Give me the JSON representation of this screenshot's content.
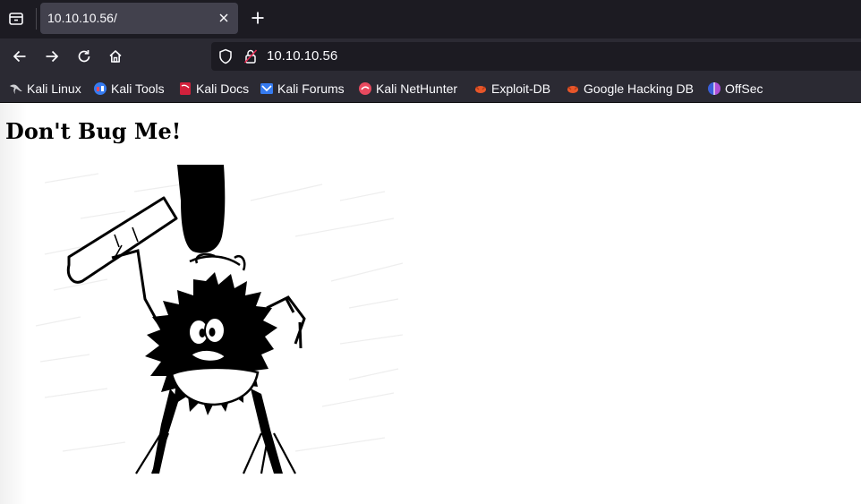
{
  "browser": {
    "tab": {
      "title": "10.10.10.56/",
      "close_icon": "close-icon"
    },
    "new_tab_icon": "plus-icon",
    "tab_list_icon": "tab-list-icon",
    "nav": {
      "back_icon": "arrow-left-icon",
      "forward_icon": "arrow-right-icon",
      "reload_icon": "reload-icon",
      "home_icon": "home-icon"
    },
    "url": "10.10.10.56",
    "bookmarks": [
      {
        "label": "Kali Linux",
        "icon": "kali-dragon-icon"
      },
      {
        "label": "Kali Tools",
        "icon": "kali-tools-icon"
      },
      {
        "label": "Kali Docs",
        "icon": "kali-docs-icon"
      },
      {
        "label": "Kali Forums",
        "icon": "kali-forums-icon"
      },
      {
        "label": "Kali NetHunter",
        "icon": "kali-nethunter-icon"
      },
      {
        "label": "Exploit-DB",
        "icon": "exploit-db-icon"
      },
      {
        "label": "Google Hacking DB",
        "icon": "ghdb-icon"
      },
      {
        "label": "OffSec",
        "icon": "offsec-icon"
      }
    ]
  },
  "page": {
    "heading": "Don't Bug Me!",
    "image_icon": "bug-with-hammer-image"
  },
  "colors": {
    "tabbar_bg": "#1c1b22",
    "toolbar_bg": "#2b2a33",
    "active_tab_bg": "#42414d",
    "text_light": "#fbfbfe",
    "page_bg": "#ffffff"
  }
}
